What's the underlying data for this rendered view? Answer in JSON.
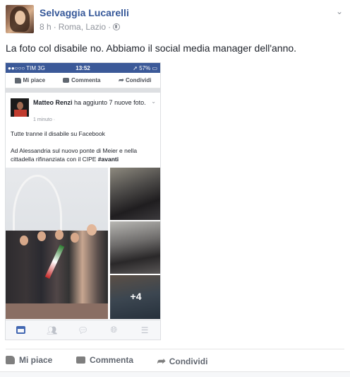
{
  "post": {
    "author": "Selvaggia Lucarelli",
    "time": "8 h",
    "location": "Roma, Lazio",
    "text": "La foto col disabile no. Abbiamo il social media manager dell'anno."
  },
  "screenshot": {
    "status": {
      "carrier": "●●○○○ TIM  3G",
      "time": "13:52",
      "battery": "➚ 57% ▭"
    },
    "actions": {
      "like": "Mi piace",
      "comment": "Commenta",
      "share": "Condividi"
    },
    "inner_post": {
      "author": "Matteo Renzi",
      "action_text": " ha aggiunto 7 nuove foto.",
      "time": "1 minuto ·",
      "line1": "Tutte tranne il disabile su Facebook",
      "line2": "Ad Alessandria sul nuovo ponte di Meier e nella cittadella rifinanziata con il CIPE",
      "hashtag": "#avanti"
    },
    "more_photos": "+4"
  },
  "actions": {
    "like": "Mi piace",
    "comment": "Commenta",
    "share": "Condividi"
  },
  "icons": [
    "globe-icon",
    "chevron-down-icon",
    "like-icon",
    "comment-icon",
    "share-icon",
    "news-feed-icon",
    "friends-icon",
    "messenger-icon",
    "notifications-icon",
    "menu-icon"
  ],
  "colors": {
    "name_link": "#365899",
    "fb_blue": "#3b5998",
    "meta_gray": "#90949c"
  }
}
